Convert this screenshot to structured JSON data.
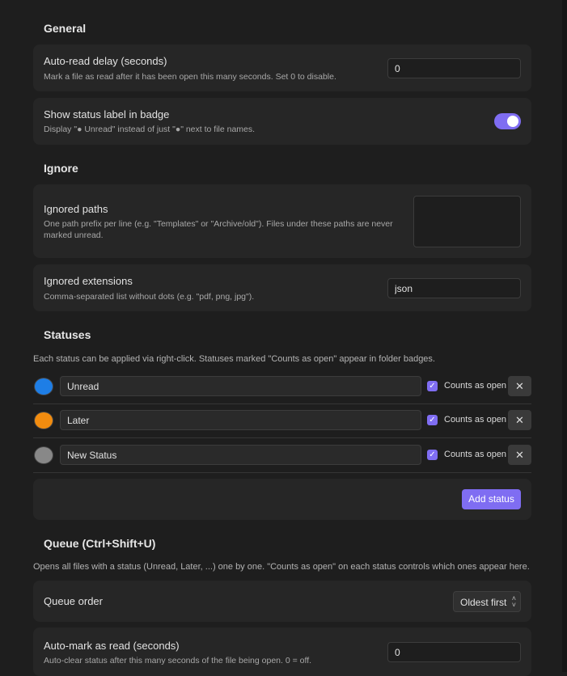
{
  "general": {
    "title": "General",
    "auto_read_delay": {
      "name": "Auto-read delay (seconds)",
      "desc": "Mark a file as read after it has been open this many seconds. Set 0 to disable.",
      "value": "0"
    },
    "status_label": {
      "name": "Show status label in badge",
      "desc": "Display \"● Unread\" instead of just \"●\" next to file names.",
      "enabled": true
    }
  },
  "ignore": {
    "title": "Ignore",
    "paths": {
      "name": "Ignored paths",
      "desc_line1": "One path prefix per line (e.g. \"Templates\" or \"Archive/old\"). Files under these paths are never",
      "desc_line2": "marked unread.",
      "value": ""
    },
    "extensions": {
      "name": "Ignored extensions",
      "desc": "Comma-separated list without dots (e.g. \"pdf, png, jpg\").",
      "value": "json"
    }
  },
  "statuses": {
    "title": "Statuses",
    "desc": "Each status can be applied via right-click. Statuses marked \"Counts as open\" appear in folder badges.",
    "counts_label": "Counts as open",
    "remove_glyph": "✕",
    "items": [
      {
        "name": "Unread",
        "color": "#1e7ee6",
        "counts_as_open": true
      },
      {
        "name": "Later",
        "color": "#f28c0f",
        "counts_as_open": true
      },
      {
        "name": "New Status",
        "color": "#888888",
        "counts_as_open": true
      }
    ],
    "add_label": "Add status"
  },
  "queue": {
    "title": "Queue (Ctrl+Shift+U)",
    "desc": "Opens all files with a status (Unread, Later, ...) one by one. \"Counts as open\" on each status controls which ones appear here.",
    "order": {
      "name": "Queue order",
      "value": "Oldest first"
    },
    "auto_mark": {
      "name": "Auto-mark as read (seconds)",
      "desc": "Auto-clear status after this many seconds of the file being open. 0 = off.",
      "value": "0"
    }
  },
  "colors": {
    "accent": "#7f6df2",
    "background": "#1e1e1e",
    "card": "#262626"
  }
}
